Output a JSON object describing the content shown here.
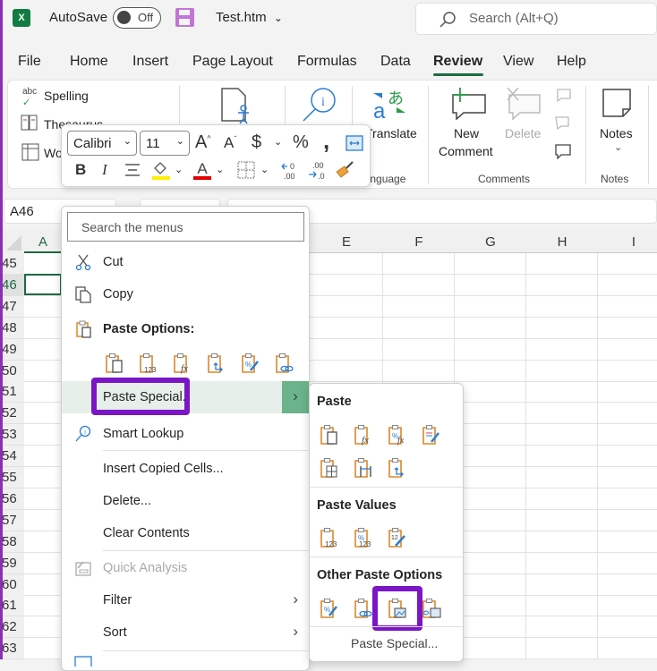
{
  "titlebar": {
    "app_icon": "excel-logo-icon",
    "autosave_label": "AutoSave",
    "autosave_state": "Off",
    "save_icon": "save-icon",
    "file_name": "Test.htm",
    "search_placeholder": "Search (Alt+Q)"
  },
  "tabs": [
    {
      "label": "File"
    },
    {
      "label": "Home"
    },
    {
      "label": "Insert"
    },
    {
      "label": "Page Layout"
    },
    {
      "label": "Formulas"
    },
    {
      "label": "Data"
    },
    {
      "label": "Review",
      "active": true
    },
    {
      "label": "View"
    },
    {
      "label": "Help"
    }
  ],
  "ribbon": {
    "proofing": {
      "spelling": "Spelling",
      "thesaurus": "Thesaurus",
      "workbook_stats": "Wo"
    },
    "language": {
      "translate": "Translate",
      "group_label": "Language"
    },
    "comments": {
      "new_comment_line1": "New",
      "new_comment_line2": "Comment",
      "delete": "Delete",
      "group_label": "Comments"
    },
    "notes": {
      "label": "Notes",
      "group_label": "Notes"
    }
  },
  "mini_toolbar": {
    "font_name": "Calibri",
    "font_size": "11",
    "increase_font": "A^",
    "decrease_font": "Aˇ",
    "currency": "$",
    "percent": "%",
    "comma": ",",
    "bold": "B",
    "italic": "I",
    "highlight_color": "#ffee00",
    "font_color": "#e00000"
  },
  "formula_bar": {
    "name_box": "A46"
  },
  "grid": {
    "columns": [
      "A",
      "E",
      "F",
      "G",
      "H",
      "I"
    ],
    "rows": [
      "45",
      "46",
      "47",
      "48",
      "49",
      "50",
      "51",
      "52",
      "53",
      "54",
      "55",
      "56",
      "57",
      "58",
      "59",
      "60",
      "61",
      "62",
      "63"
    ],
    "selected_cell": "A46"
  },
  "context_menu": {
    "search_placeholder": "Search the menus",
    "items": {
      "cut": "Cut",
      "copy": "Copy",
      "paste_options_header": "Paste Options:",
      "paste_special": "Paste Special.",
      "smart_lookup": "Smart Lookup",
      "insert_copied_cells": "Insert Copied Cells...",
      "delete": "Delete...",
      "clear_contents": "Clear Contents",
      "quick_analysis": "Quick Analysis",
      "filter": "Filter",
      "sort": "Sort"
    },
    "paste_option_icons": [
      "paste-icon",
      "paste-values-icon",
      "paste-formulas-icon",
      "paste-transpose-icon",
      "paste-formatting-icon",
      "paste-link-icon"
    ]
  },
  "submenu": {
    "paste_header": "Paste",
    "paste_icons": [
      "paste-icon",
      "formulas-icon",
      "formulas-number-formatting-icon",
      "keep-source-formatting-icon",
      "no-borders-icon",
      "keep-column-widths-icon",
      "transpose-icon"
    ],
    "paste_values_header": "Paste Values",
    "paste_values_icons": [
      "values-icon",
      "values-number-formatting-icon",
      "values-source-formatting-icon"
    ],
    "other_header": "Other Paste Options",
    "other_icons": [
      "formatting-icon",
      "paste-link-icon",
      "picture-icon",
      "linked-picture-icon"
    ],
    "paste_special_link": "Paste Special..."
  },
  "colors": {
    "accent_green": "#1e6b41",
    "highlight_purple": "#7b16c7",
    "clipboard_orange": "#d9892b"
  }
}
